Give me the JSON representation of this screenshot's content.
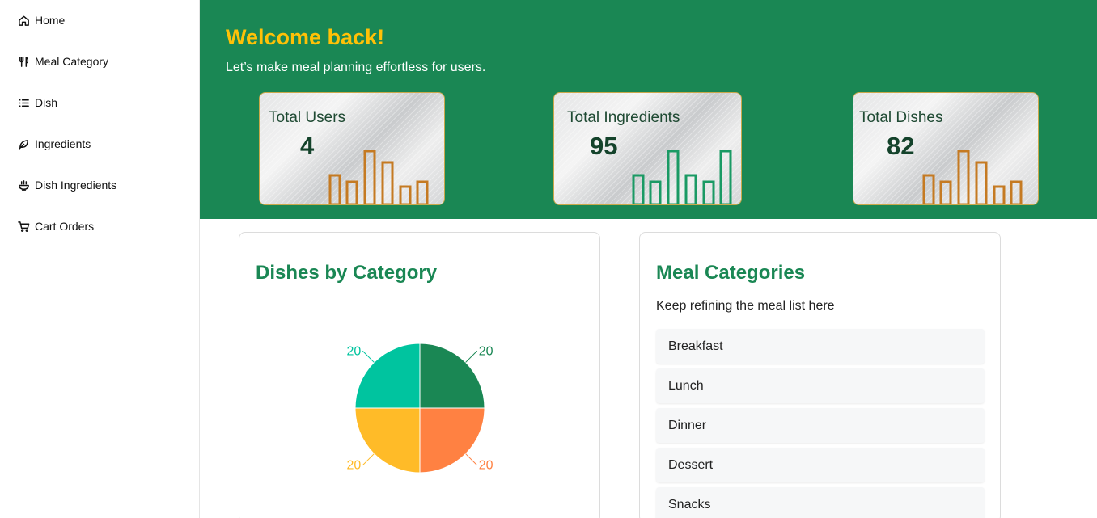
{
  "sidebar": {
    "items": [
      {
        "label": "Home",
        "icon": "home-icon"
      },
      {
        "label": "Meal Category",
        "icon": "utensils-icon"
      },
      {
        "label": "Dish",
        "icon": "list-icon"
      },
      {
        "label": "Ingredients",
        "icon": "leaf-icon"
      },
      {
        "label": "Dish Ingredients",
        "icon": "bowl-icon"
      },
      {
        "label": "Cart Orders",
        "icon": "cart-icon"
      }
    ]
  },
  "banner": {
    "title": "Welcome back!",
    "subtitle": "Let’s make meal planning effortless for users.",
    "colors": {
      "background": "#1a8754",
      "title": "#ffc107"
    }
  },
  "stats": [
    {
      "label": "Total Users",
      "value": "4",
      "bar_color": "#c57a22"
    },
    {
      "label": "Total Ingredients",
      "value": "95",
      "bar_color": "#1a9a64"
    },
    {
      "label": "Total Dishes",
      "value": "82",
      "bar_color": "#c57a22"
    }
  ],
  "dishes_panel": {
    "title": "Dishes by Category"
  },
  "categories_panel": {
    "title": "Meal Categories",
    "subtitle": "Keep refining the meal list here",
    "items": [
      "Breakfast",
      "Lunch",
      "Dinner",
      "Dessert",
      "Snacks"
    ]
  },
  "chart_data": {
    "type": "pie",
    "title": "Dishes by Category",
    "values": [
      20,
      20,
      20,
      20
    ],
    "colors": [
      "#1a8754",
      "#ff8142",
      "#ffbb28",
      "#00c49f"
    ],
    "data_labels": [
      "20",
      "20",
      "20",
      "20"
    ]
  }
}
